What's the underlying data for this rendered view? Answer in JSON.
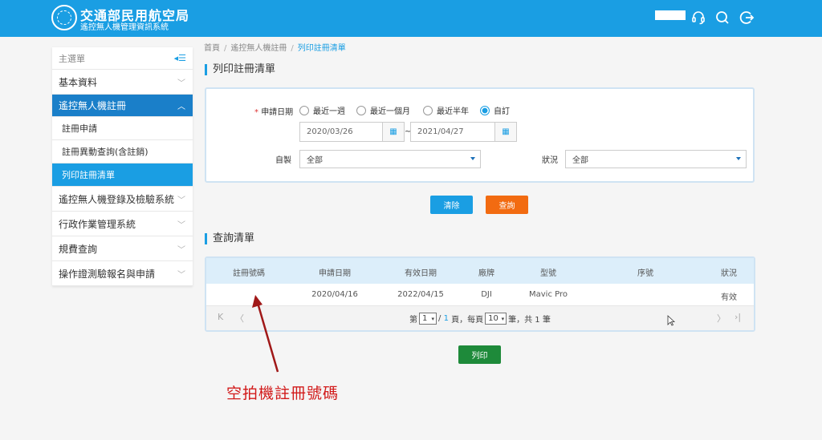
{
  "header": {
    "title": "交通部民用航空局",
    "subtitle": "遙控無人機管理資訊系統",
    "icons": [
      "support-icon",
      "search-icon",
      "logout-icon"
    ]
  },
  "sidebar": {
    "menu_label": "主選單",
    "items": [
      {
        "label": "基本資料"
      },
      {
        "label": "遙控無人機註冊",
        "active": true
      },
      {
        "label": "遙控無人機登錄及檢驗系統"
      },
      {
        "label": "行政作業管理系統"
      },
      {
        "label": "規費查詢"
      },
      {
        "label": "操作證測驗報名與申請"
      }
    ],
    "subitems": [
      {
        "label": "註冊申請"
      },
      {
        "label": "註冊異動查詢(含註銷)"
      },
      {
        "label": "列印註冊清單",
        "active": true
      }
    ]
  },
  "breadcrumb": [
    "首頁",
    "遙控無人機註冊",
    "列印註冊清單"
  ],
  "page_title": "列印註冊清單",
  "form": {
    "date_label": "申請日期",
    "required_mark": "*",
    "date_options": [
      "最近一週",
      "最近一個月",
      "最近半年",
      "自訂"
    ],
    "date_selected": "自訂",
    "date_from": "2020/03/26",
    "date_to": "2021/04/27",
    "range_sep": "~",
    "self_made_label": "自製",
    "self_made_value": "全部",
    "status_label": "狀況",
    "status_value": "全部"
  },
  "buttons": {
    "clear": "清除",
    "query": "查詢",
    "print": "列印"
  },
  "colors": {
    "header": "#1a9ee3",
    "clear_button": "#1a9ee3",
    "query_button": "#f26b11",
    "print_button": "#1e8a3a",
    "annotation": "#d21a1a"
  },
  "results": {
    "title": "查詢清單",
    "columns": [
      "註冊號碼",
      "申請日期",
      "有效日期",
      "廠牌",
      "型號",
      "序號",
      "狀況"
    ],
    "rows": [
      [
        "",
        "2020/04/16",
        "2022/04/15",
        "DJI",
        "Mavic Pro",
        "",
        "有效"
      ]
    ],
    "pager": {
      "prefix": "第",
      "page": "1",
      "slash": "/",
      "total_pages": "1",
      "mid": "頁，每頁",
      "per_page": "10",
      "suffix": "筆，共 1 筆",
      "first": "K",
      "prev": "〈",
      "next": "〉",
      "last": "›|"
    }
  },
  "annotation": "空拍機註冊號碼"
}
